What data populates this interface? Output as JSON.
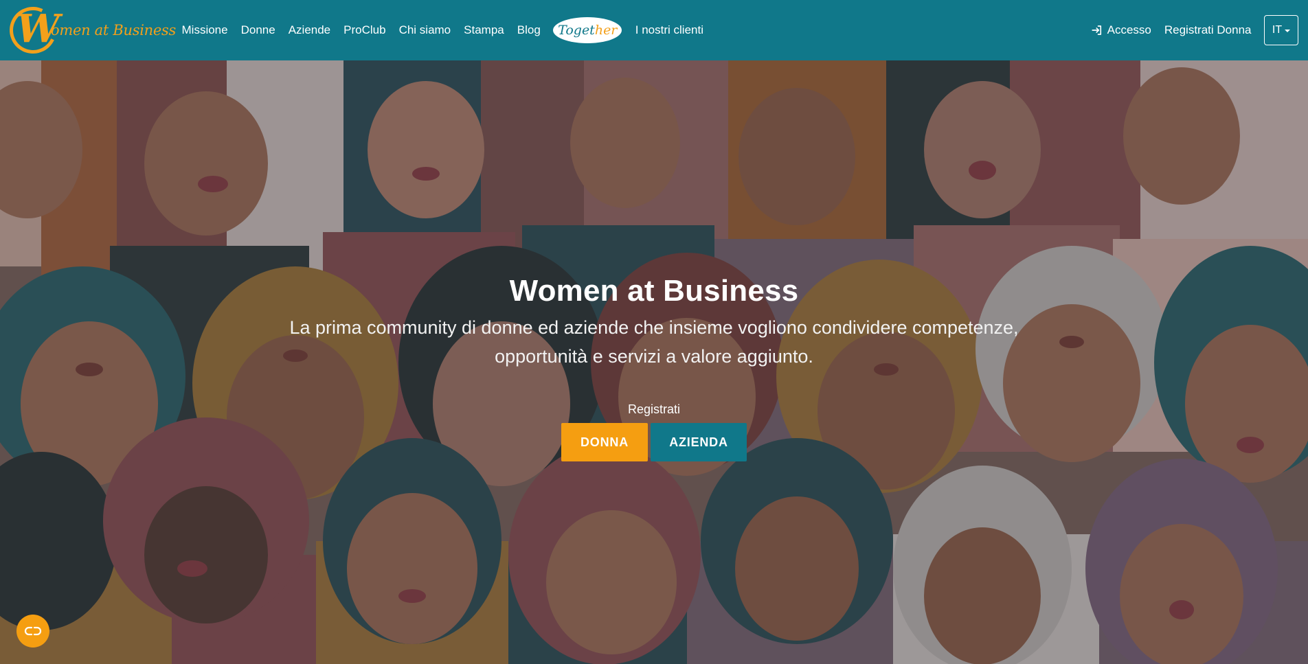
{
  "brand": {
    "initial": "W",
    "name": "omen at Business"
  },
  "nav": {
    "links": [
      {
        "label": "Missione"
      },
      {
        "label": "Donne"
      },
      {
        "label": "Aziende"
      },
      {
        "label": "ProClub"
      },
      {
        "label": "Chi siamo"
      },
      {
        "label": "Stampa"
      },
      {
        "label": "Blog"
      }
    ],
    "together": {
      "part1": "Toget",
      "part2": "her"
    },
    "clients_label": "I nostri clienti",
    "login_label": "Accesso",
    "login_icon": "login-arrow-icon",
    "register_label": "Registrati Donna",
    "language": "IT"
  },
  "hero": {
    "title": "Women at Business",
    "subtitle": "La prima community di donne ed aziende che insieme vogliono condividere competenze, opportunità e servizi a valore aggiunto.",
    "register_label": "Registrati",
    "donna_button": "DONNA",
    "azienda_button": "AZIENDA"
  },
  "floating": {
    "icon": "cookie-settings-icon"
  },
  "colors": {
    "navbar": "#10788a",
    "accent": "#f59e11",
    "teal": "#10788a"
  }
}
